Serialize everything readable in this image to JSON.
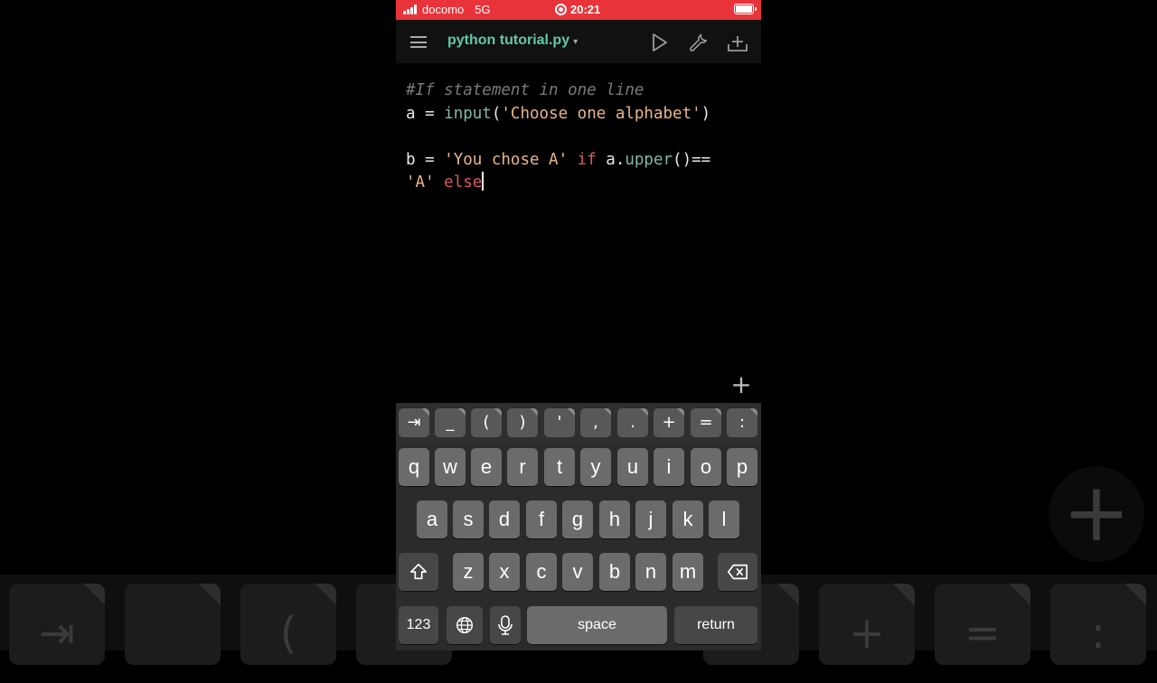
{
  "status_bar": {
    "carrier": "docomo",
    "network": "5G",
    "time": "20:21"
  },
  "toolbar": {
    "file_name": "python tutorial.py",
    "caret": "▾"
  },
  "editor": {
    "line1": "#If statement in one line",
    "line2_a": "a = ",
    "line2_fn": "input",
    "line2_open": "(",
    "line2_str": "'Choose one alphabet'",
    "line2_close": ")",
    "line4_a": "b = ",
    "line4_str1": "'You chose A'",
    "line4_if": "if",
    "line4_obj": " a.",
    "line4_fn": "upper",
    "line4_rest": "()==",
    "line5_str": "'A'",
    "line5_else": "else"
  },
  "fab": {
    "label": "+"
  },
  "accessory_keys": [
    "⇥",
    "_",
    "(",
    ")",
    "'",
    ",",
    ".",
    "+",
    "=",
    ":"
  ],
  "keyboard": {
    "row1": [
      "q",
      "w",
      "e",
      "r",
      "t",
      "y",
      "u",
      "i",
      "o",
      "p"
    ],
    "row2": [
      "a",
      "s",
      "d",
      "f",
      "g",
      "h",
      "j",
      "k",
      "l"
    ],
    "row3": [
      "z",
      "x",
      "c",
      "v",
      "b",
      "n",
      "m"
    ],
    "numbers_label": "123",
    "space_label": "space",
    "return_label": "return"
  },
  "background": {
    "keys": [
      "⇥",
      "",
      "(",
      "",
      "",
      "",
      "",
      "+",
      "=",
      ":"
    ],
    "plus": "+"
  },
  "colors": {
    "status_bar": "#e8333a",
    "file_title": "#62c7a8",
    "comment": "#7a7a7a",
    "function": "#7fb9a6",
    "string": "#e9b58a",
    "keyword": "#d85b62"
  }
}
